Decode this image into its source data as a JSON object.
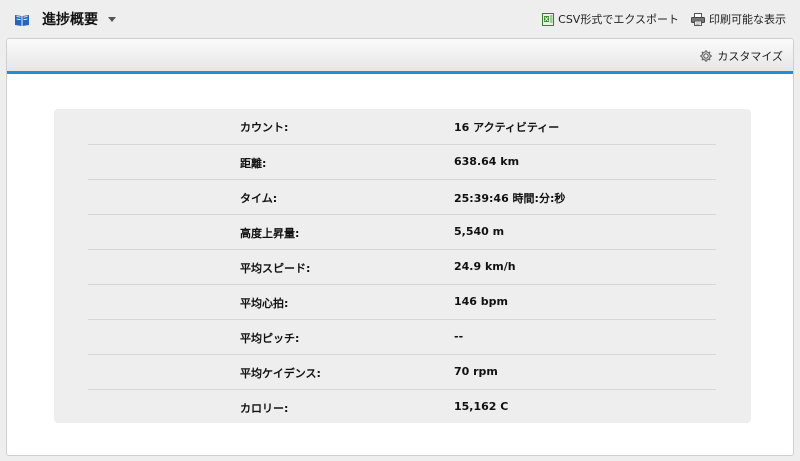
{
  "header": {
    "title": "進捗概要",
    "export_csv_label": "CSV形式でエクスポート",
    "print_label": "印刷可能な表示"
  },
  "panel": {
    "customize_label": "カスタマイズ",
    "accent_color": "#1c8fdc"
  },
  "stats": [
    {
      "label": "カウント:",
      "value": "16 アクティビティー"
    },
    {
      "label": "距離:",
      "value": "638.64 km"
    },
    {
      "label": "タイム:",
      "value": "25:39:46 時間:分:秒"
    },
    {
      "label": "高度上昇量:",
      "value": "5,540 m"
    },
    {
      "label": "平均スピード:",
      "value": "24.9 km/h"
    },
    {
      "label": "平均心拍:",
      "value": "146 bpm"
    },
    {
      "label": "平均ピッチ:",
      "value": "--"
    },
    {
      "label": "平均ケイデンス:",
      "value": "70 rpm"
    },
    {
      "label": "カロリー:",
      "value": "15,162 C"
    }
  ],
  "icons": {
    "title": "book-icon",
    "title_menu": "caret-down-icon",
    "export": "spreadsheet-icon",
    "print": "printer-icon",
    "customize": "gear-icon"
  }
}
